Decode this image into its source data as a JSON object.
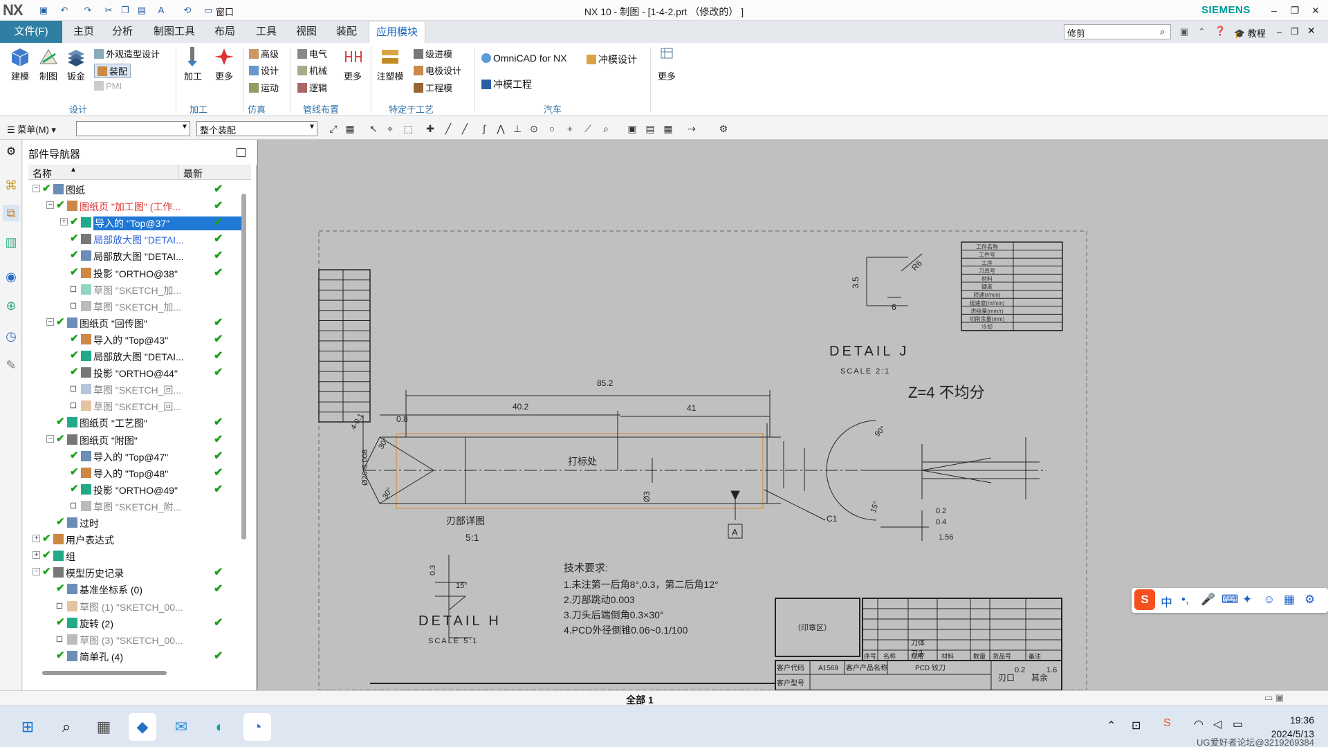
{
  "titlebar": {
    "logo": "NX",
    "window_menu": "窗口",
    "title": "NX 10 - 制图 - [1-4-2.prt （修改的） ]",
    "brand": "SIEMENS"
  },
  "menubar": {
    "file": "文件(F)",
    "tabs": [
      "主页",
      "分析",
      "制图工具",
      "布局",
      "工具",
      "视图",
      "装配",
      "应用模块"
    ],
    "active_tab": "应用模块",
    "search_value": "修剪",
    "tutorial": "教程"
  },
  "ribbon": {
    "design_big": [
      "建模",
      "制图",
      "钣金"
    ],
    "design_small": [
      "外观造型设计",
      "装配",
      "PMI"
    ],
    "machining": [
      "加工",
      "更多"
    ],
    "sim": [
      "高级",
      "设计",
      "运动"
    ],
    "routing": [
      "电气",
      "机械",
      "逻辑",
      "更多"
    ],
    "process": [
      "级进模",
      "电极设计",
      "工程模",
      "注塑模"
    ],
    "auto": [
      "OmniCAD for NX",
      "冲模设计",
      "冲模工程"
    ],
    "more": "更多",
    "groups": [
      "设计",
      "加工",
      "仿真",
      "管线布置",
      "特定于工艺",
      "汽车"
    ]
  },
  "toolbar": {
    "menu": "菜单(M)",
    "filter_value": "",
    "scope_value": "整个装配"
  },
  "navigator": {
    "title": "部件导航器",
    "col_name": "名称",
    "col_latest": "最新",
    "rows": [
      {
        "label": "图纸",
        "indent": 0,
        "exp": "−",
        "style": ""
      },
      {
        "label": "图纸页 \"加工图\" (工作...",
        "indent": 1,
        "exp": "−",
        "style": "red"
      },
      {
        "label": "导入的 \"Top@37\"",
        "indent": 2,
        "exp": "+",
        "style": "sel"
      },
      {
        "label": "局部放大图 \"DETAI...",
        "indent": 2,
        "exp": "",
        "style": "blue"
      },
      {
        "label": "局部放大图 \"DETAI...",
        "indent": 2,
        "exp": "",
        "style": ""
      },
      {
        "label": "投影 \"ORTHO@38\"",
        "indent": 2,
        "exp": "",
        "style": ""
      },
      {
        "label": "草图 \"SKETCH_加...",
        "indent": 2,
        "exp": "",
        "style": "gray"
      },
      {
        "label": "草图 \"SKETCH_加...",
        "indent": 2,
        "exp": "",
        "style": "gray"
      },
      {
        "label": "图纸页 \"回传图\"",
        "indent": 1,
        "exp": "−",
        "style": ""
      },
      {
        "label": "导入的 \"Top@43\"",
        "indent": 2,
        "exp": "",
        "style": ""
      },
      {
        "label": "局部放大图 \"DETAI...",
        "indent": 2,
        "exp": "",
        "style": ""
      },
      {
        "label": "投影 \"ORTHO@44\"",
        "indent": 2,
        "exp": "",
        "style": ""
      },
      {
        "label": "草图 \"SKETCH_回...",
        "indent": 2,
        "exp": "",
        "style": "gray"
      },
      {
        "label": "草图 \"SKETCH_回...",
        "indent": 2,
        "exp": "",
        "style": "gray"
      },
      {
        "label": "图纸页 \"工艺图\"",
        "indent": 1,
        "exp": "",
        "style": ""
      },
      {
        "label": "图纸页 \"附图\"",
        "indent": 1,
        "exp": "−",
        "style": ""
      },
      {
        "label": "导入的 \"Top@47\"",
        "indent": 2,
        "exp": "",
        "style": ""
      },
      {
        "label": "导入的 \"Top@48\"",
        "indent": 2,
        "exp": "",
        "style": ""
      },
      {
        "label": "投影 \"ORTHO@49\"",
        "indent": 2,
        "exp": "",
        "style": ""
      },
      {
        "label": "草图 \"SKETCH_附...",
        "indent": 2,
        "exp": "",
        "style": "gray"
      },
      {
        "label": "过时",
        "indent": 1,
        "exp": "",
        "style": ""
      },
      {
        "label": "用户表达式",
        "indent": 0,
        "exp": "+",
        "style": ""
      },
      {
        "label": "组",
        "indent": 0,
        "exp": "+",
        "style": ""
      },
      {
        "label": "模型历史记录",
        "indent": 0,
        "exp": "−",
        "style": ""
      },
      {
        "label": "基准坐标系 (0)",
        "indent": 1,
        "exp": "",
        "style": ""
      },
      {
        "label": "草图 (1) \"SKETCH_00...",
        "indent": 1,
        "exp": "",
        "style": "gray"
      },
      {
        "label": "旋转 (2)",
        "indent": 1,
        "exp": "",
        "style": ""
      },
      {
        "label": "草图 (3) \"SKETCH_00...",
        "indent": 1,
        "exp": "",
        "style": "gray"
      },
      {
        "label": "简单孔 (4)",
        "indent": 1,
        "exp": "",
        "style": ""
      }
    ]
  },
  "drawing": {
    "detail_j": "DETAIL J",
    "scale_j": "SCALE 2:1",
    "z_note": "Z=4 不均分",
    "dim_852": "85.2",
    "dim_402": "40.2",
    "dim_41": "41",
    "dim_08": "0.8",
    "dim_4": "4-0.1",
    "mark_text": "打标处",
    "edge_detail": "刃部详图",
    "edge_scale": "5:1",
    "label_a": "A",
    "label_c1": "C1",
    "dim_3": "Ø3",
    "dim_20": "Ø20-0.008",
    "angle_30": "30°",
    "r6": "R6",
    "dim_35": "3.5",
    "dim_6": "6",
    "ang_90": "90°",
    "ang_15": "15°",
    "d02": "0.2",
    "d04": "0.4",
    "d156": "1.56",
    "d03": "0.3",
    "d15": "15°",
    "detail_h": "DETAIL H",
    "scale_h": "SCALE 5:1",
    "tech_title": "技术要求:",
    "tech": [
      "1.未注第一后角8°,0.3，第二后角12°",
      "2.刃部跳动0.003",
      "3.刀头后端倒角0.3×30°",
      "4.PCD外径倒锥0.06~0.1/100"
    ],
    "stamp": "（印章区）",
    "params": [
      "工件名称",
      "工件号",
      "工序",
      "刀具号",
      "材料",
      "硬度",
      "转速(r/min)",
      "线速度(m/min)",
      "进给量(mm/r)",
      "切削余量(mm)",
      "冷却"
    ],
    "tb_client_code": "客户代码",
    "tb_code": "A1569",
    "tb_product": "客户产品名称",
    "tb_pcd": "PCD 铰刀",
    "tb_model": "客户型号",
    "tb_hdr": [
      "序号",
      "名称",
      "规格",
      "材料",
      "数量",
      "货品号",
      "备注"
    ],
    "tb_rows": [
      "刀体",
      "刀头"
    ],
    "tb_edge": "刃口",
    "tb_rest": "其余",
    "tb_r1": "0.2",
    "tb_r2": "1.6"
  },
  "status": "全部 1",
  "taskbar": {
    "time": "19:36",
    "date": "2024/5/13",
    "ime": "中",
    "watermark": "UG爱好者论坛@3219269384"
  }
}
